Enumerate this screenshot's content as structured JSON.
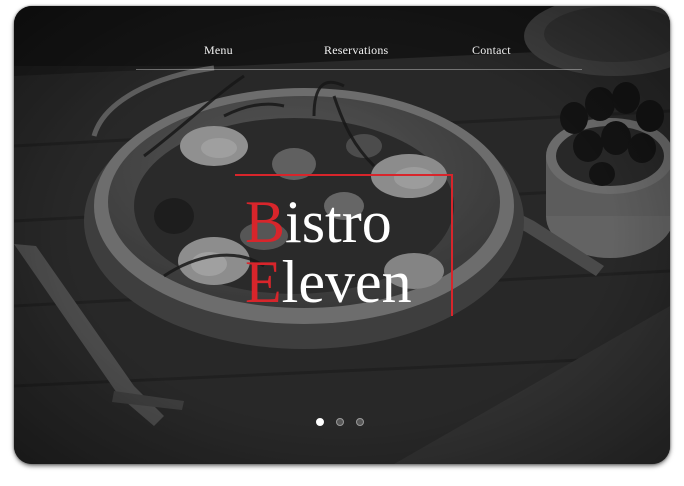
{
  "nav": {
    "items": [
      {
        "label": "Menu"
      },
      {
        "label": "Reservations"
      },
      {
        "label": "Contact"
      }
    ]
  },
  "logo": {
    "line1_initial": "B",
    "line1_rest": "istro",
    "line2_initial": "E",
    "line2_rest": "leven",
    "accent_color": "#d8252b"
  },
  "carousel": {
    "slide_count": 3,
    "active_index": 0
  },
  "hero": {
    "image": "grayscale photo of a salad bowl with fork and olives on a wooden board"
  }
}
